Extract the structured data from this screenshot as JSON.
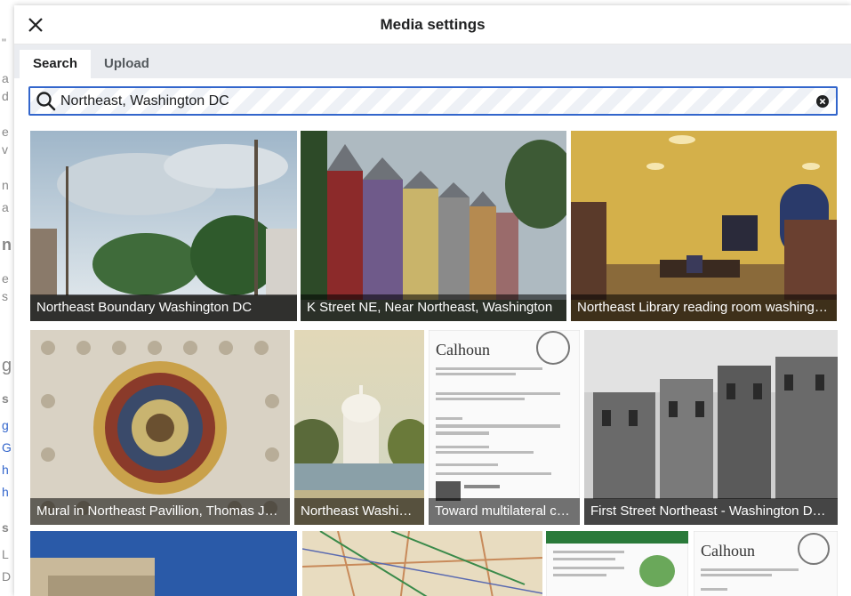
{
  "dialog": {
    "title": "Media settings",
    "close_icon": "close-icon"
  },
  "tabs": [
    {
      "label": "Search",
      "active": true
    },
    {
      "label": "Upload",
      "active": false
    }
  ],
  "search": {
    "value": "Northeast, Washington DC",
    "icon": "search-icon",
    "clear_icon": "clear-icon"
  },
  "results": [
    {
      "caption": "Northeast Boundary Washington DC",
      "scene": "street-sky"
    },
    {
      "caption": "K Street NE, Near Northeast, Washington",
      "scene": "rowhouses"
    },
    {
      "caption": "Northeast Library reading room washingt…",
      "scene": "library"
    },
    {
      "caption": "Mural in Northeast Pavillion, Thomas Je…",
      "scene": "ceiling"
    },
    {
      "caption": "Northeast Washin…",
      "scene": "capitol"
    },
    {
      "caption": "Toward multilateral c…",
      "scene": "document"
    },
    {
      "caption": "First Street Northeast - Washington DC…",
      "scene": "old-photo"
    },
    {
      "caption": "",
      "scene": "building-sky"
    },
    {
      "caption": "",
      "scene": "map"
    },
    {
      "caption": "",
      "scene": "doc-green"
    },
    {
      "caption": "",
      "scene": "document"
    }
  ]
}
